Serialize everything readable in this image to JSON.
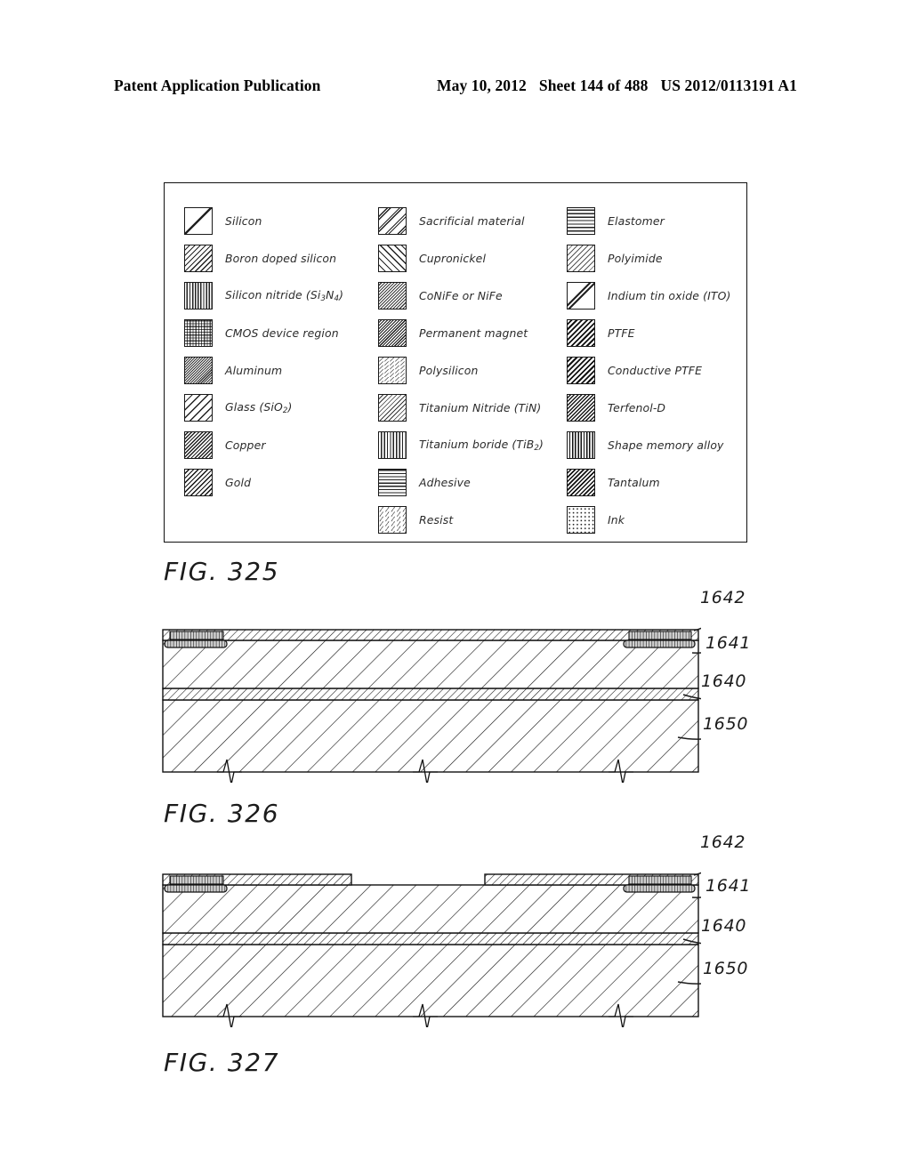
{
  "header": {
    "publication": "Patent Application Publication",
    "date": "May 10, 2012",
    "sheet": "Sheet 144 of 488",
    "docnumber": "US 2012/0113191 A1"
  },
  "legend": {
    "columns": [
      {
        "items": [
          {
            "pattern": "silicon",
            "label": "Silicon"
          },
          {
            "pattern": "boron",
            "label": "Boron doped silicon"
          },
          {
            "pattern": "sinitride",
            "label": "Silicon nitride (Si3N4)"
          },
          {
            "pattern": "cmos",
            "label": "CMOS device region"
          },
          {
            "pattern": "aluminum",
            "label": "Aluminum"
          },
          {
            "pattern": "glass",
            "label": "Glass (SiO2)"
          },
          {
            "pattern": "copper",
            "label": "Copper"
          },
          {
            "pattern": "gold",
            "label": "Gold"
          }
        ]
      },
      {
        "items": [
          {
            "pattern": "sacrificial",
            "label": "Sacrificial material"
          },
          {
            "pattern": "cupronickel",
            "label": "Cupronickel"
          },
          {
            "pattern": "conife",
            "label": "CoNiFe or NiFe"
          },
          {
            "pattern": "magnet",
            "label": "Permanent magnet"
          },
          {
            "pattern": "polysilicon",
            "label": "Polysilicon"
          },
          {
            "pattern": "tin",
            "label": "Titanium Nitride (TiN)"
          },
          {
            "pattern": "tib2",
            "label": "Titanium boride (TiB2)"
          },
          {
            "pattern": "adhesive",
            "label": "Adhesive"
          },
          {
            "pattern": "resist",
            "label": "Resist"
          }
        ]
      },
      {
        "items": [
          {
            "pattern": "elastomer",
            "label": "Elastomer"
          },
          {
            "pattern": "polyimide",
            "label": "Polyimide"
          },
          {
            "pattern": "ito",
            "label": "Indium tin oxide (ITO)"
          },
          {
            "pattern": "ptfe",
            "label": "PTFE"
          },
          {
            "pattern": "cptfe",
            "label": "Conductive PTFE"
          },
          {
            "pattern": "terfenol",
            "label": "Terfenol-D"
          },
          {
            "pattern": "sma",
            "label": "Shape memory alloy"
          },
          {
            "pattern": "tantalum",
            "label": "Tantalum"
          },
          {
            "pattern": "ink",
            "label": "Ink"
          }
        ]
      }
    ]
  },
  "figures": [
    {
      "caption": "FIG. 325"
    },
    {
      "caption": "FIG. 326",
      "refnums": [
        "1642",
        "1641",
        "1640",
        "1650"
      ]
    },
    {
      "caption": "FIG. 327",
      "refnums": [
        "1642",
        "1641",
        "1640",
        "1650"
      ]
    }
  ]
}
